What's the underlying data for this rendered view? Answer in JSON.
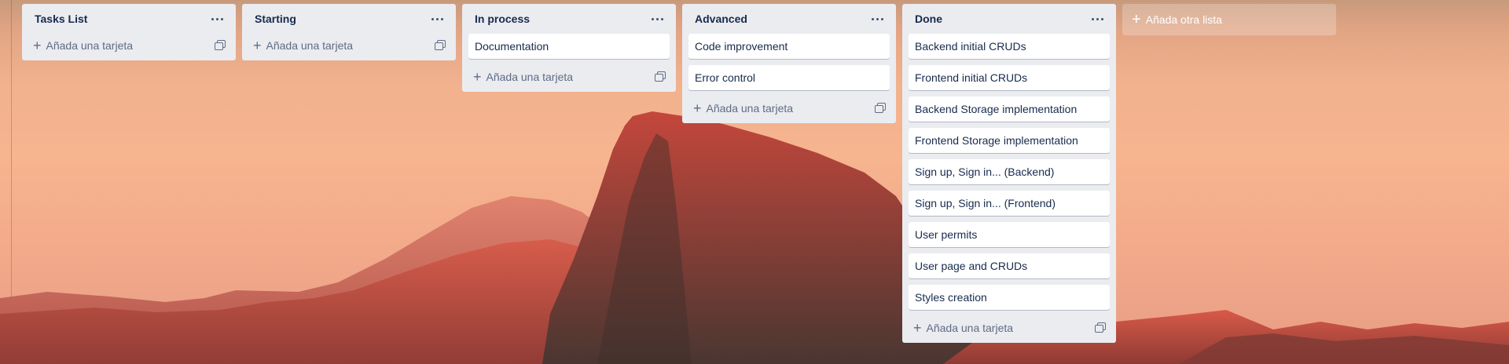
{
  "board": {
    "lists": [
      {
        "title": "Tasks List",
        "cards": []
      },
      {
        "title": "Starting",
        "cards": []
      },
      {
        "title": "In process",
        "cards": [
          "Documentation"
        ]
      },
      {
        "title": "Advanced",
        "cards": [
          "Code improvement",
          "Error control"
        ]
      },
      {
        "title": "Done",
        "cards": [
          "Backend initial CRUDs",
          "Frontend initial CRUDs",
          "Backend Storage implementation",
          "Frontend Storage implementation",
          "Sign up, Sign in... (Backend)",
          "Sign up, Sign in... (Frontend)",
          "User permits",
          "User page and CRUDs",
          "Styles creation"
        ]
      }
    ],
    "add_card_label": "Añada una tarjeta",
    "add_list_label": "Añada otra lista",
    "icons": {
      "menu": "ellipsis-icon",
      "add": "plus-icon",
      "template": "card-template-icon"
    }
  },
  "colors": {
    "list_bg": "#ebecf0",
    "card_bg": "#ffffff",
    "text": "#172b4d",
    "muted": "#5e6c84"
  }
}
